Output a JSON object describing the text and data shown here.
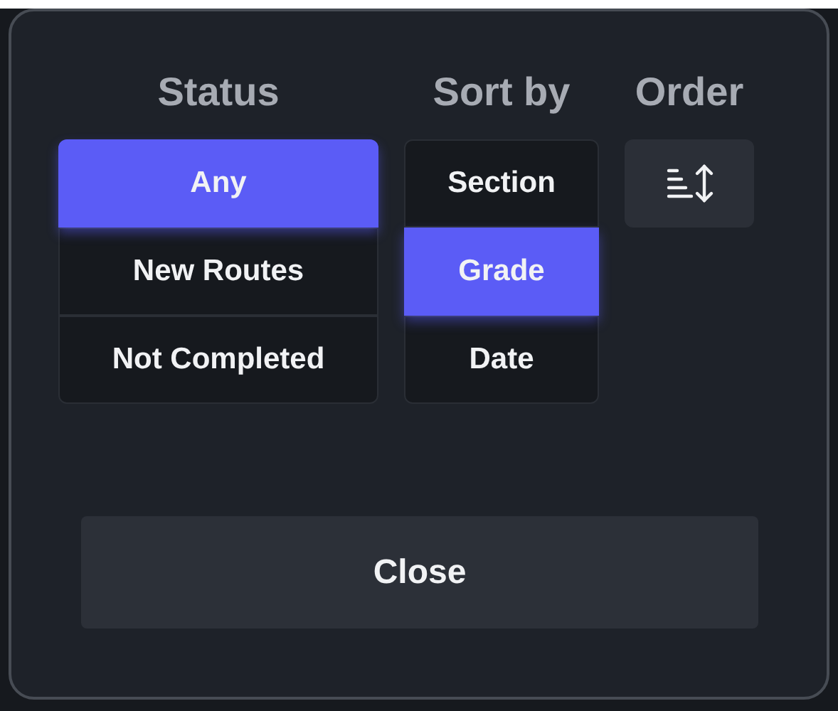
{
  "status": {
    "heading": "Status",
    "options": [
      {
        "label": "Any",
        "selected": true
      },
      {
        "label": "New Routes",
        "selected": false
      },
      {
        "label": "Not Completed",
        "selected": false
      }
    ]
  },
  "sort_by": {
    "heading": "Sort by",
    "options": [
      {
        "label": "Section",
        "selected": false
      },
      {
        "label": "Grade",
        "selected": true
      },
      {
        "label": "Date",
        "selected": false
      }
    ]
  },
  "order": {
    "heading": "Order"
  },
  "close_button": "Close"
}
